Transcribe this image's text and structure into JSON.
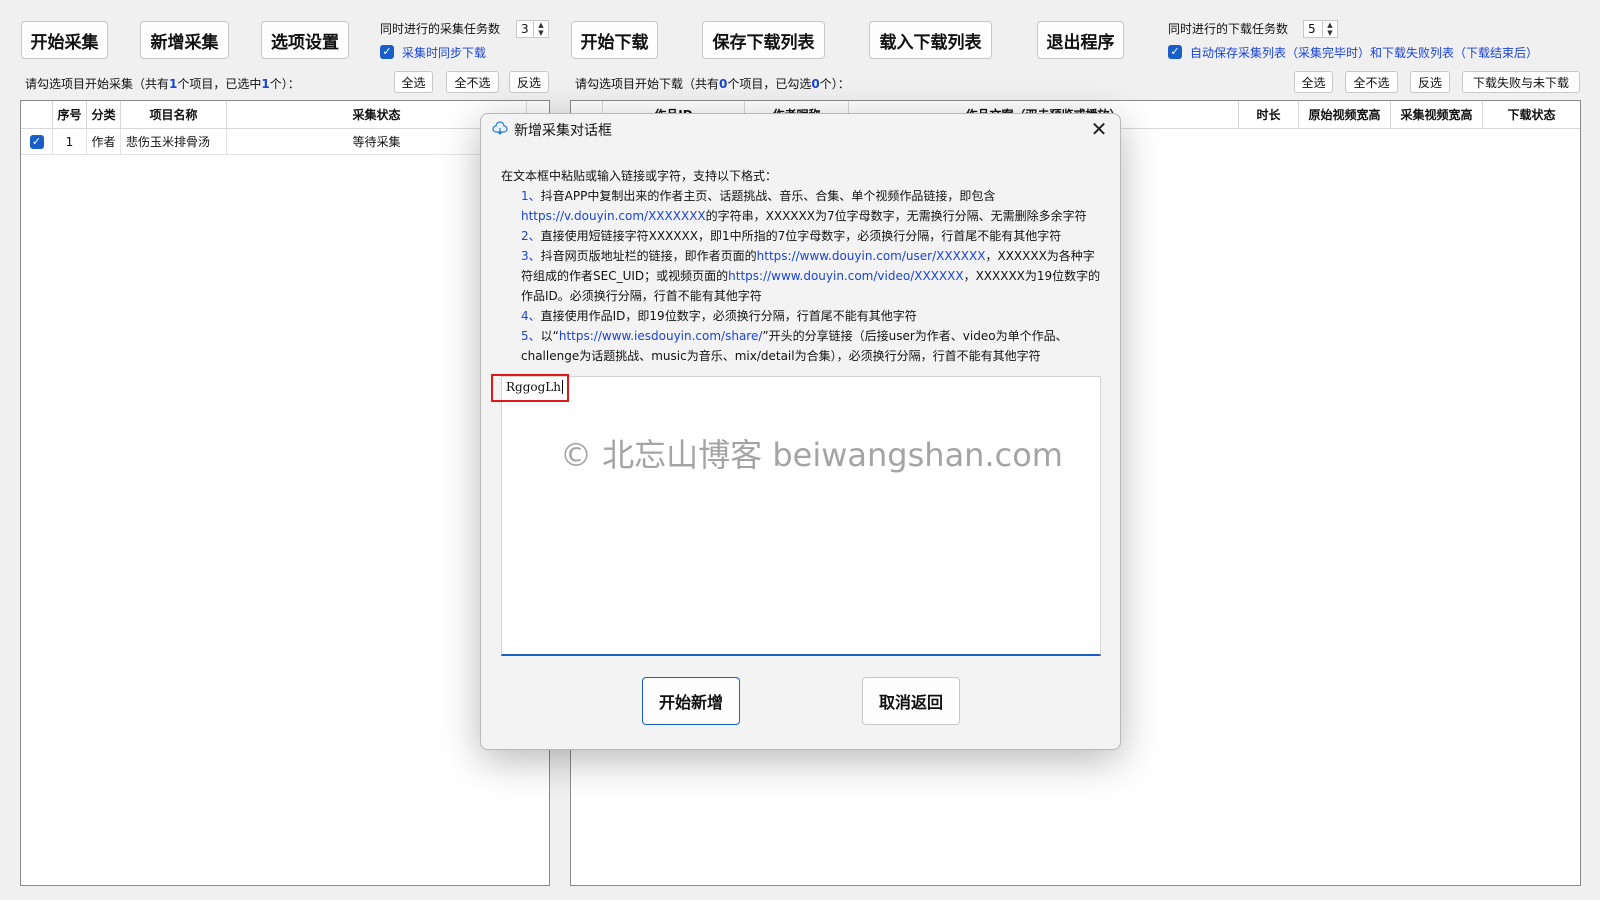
{
  "toolbar": {
    "start_collect": "开始采集",
    "add_collect": "新增采集",
    "options": "选项设置",
    "start_download": "开始下载",
    "save_download_list": "保存下载列表",
    "load_download_list": "载入下载列表",
    "exit": "退出程序"
  },
  "collect_settings": {
    "concurrent_label": "同时进行的采集任务数",
    "concurrent_value": "3",
    "sync_download_label": "采集时同步下载",
    "sync_download_checked": true
  },
  "download_settings": {
    "concurrent_label": "同时进行的下载任务数",
    "concurrent_value": "5",
    "autosave_label": "自动保存采集列表（采集完毕时）和下载失败列表（下载结束后）",
    "autosave_checked": true
  },
  "left_panel": {
    "status_prefix": "请勾选项目开始采集（共有",
    "total": "1",
    "status_mid": "个项目，已选中",
    "selected": "1",
    "status_suffix": "个）：",
    "select_all": "全选",
    "select_none": "全不选",
    "invert": "反选",
    "columns": [
      "序号",
      "分类",
      "项目名称",
      "采集状态"
    ],
    "rows": [
      {
        "checked": true,
        "index": "1",
        "category": "作者",
        "name": "悲伤玉米排骨汤",
        "status": "等待采集"
      }
    ]
  },
  "right_panel": {
    "status_prefix": "请勾选项目开始下载（共有",
    "total": "0",
    "status_mid": "个项目，已勾选",
    "selected": "0",
    "status_suffix": "个）：",
    "select_all": "全选",
    "select_none": "全不选",
    "invert": "反选",
    "download_failed": "下载失败与未下载",
    "columns": [
      "作品ID",
      "作者昵称",
      "作品文案（双击预览或播放）",
      "时长",
      "原始视频宽高",
      "采集视频宽高",
      "下载状态"
    ]
  },
  "dialog": {
    "title": "新增采集对话框",
    "intro": "在文本框中粘贴或输入链接或字符，支持以下格式：",
    "item1_num": "1、",
    "item1_a": "抖音APP中复制出来的作者主页、话题挑战、音乐、合集、单个视频作品链接，即包含",
    "item1_link": "https://v.douyin.com/XXXXXXX",
    "item1_b": "的字符串，XXXXXX为7位字母数字，无需换行分隔、无需删除多余字符",
    "item2_num": "2、",
    "item2": "直接使用短链接字符XXXXXX，即1中所指的7位字母数字，必须换行分隔，行首尾不能有其他字符",
    "item3_num": "3、",
    "item3_a": "抖音网页版地址栏的链接，即作者页面的",
    "item3_link1": "https://www.douyin.com/user/XXXXXX",
    "item3_b": "，XXXXXX为各种字符组成的作者SEC_UID；或视频页面的",
    "item3_link2": "https://www.douyin.com/video/XXXXXX",
    "item3_c": "，XXXXXX为19位数字的作品ID。必须换行分隔，行首不能有其他字符",
    "item4_num": "4、",
    "item4": "直接使用作品ID，即19位数字，必须换行分隔，行首尾不能有其他字符",
    "item5_num": "5、",
    "item5_a": "以“",
    "item5_link": "https://www.iesdouyin.com/share/",
    "item5_b": "”开头的分享链接（后接user为作者、video为单个作品、challenge为话题挑战、music为音乐、mix/detail为合集），必须换行分隔，行首不能有其他字符",
    "input_value": "RggogLh",
    "watermark": "© 北忘山博客 beiwangshan.com",
    "confirm": "开始新增",
    "cancel": "取消返回"
  }
}
